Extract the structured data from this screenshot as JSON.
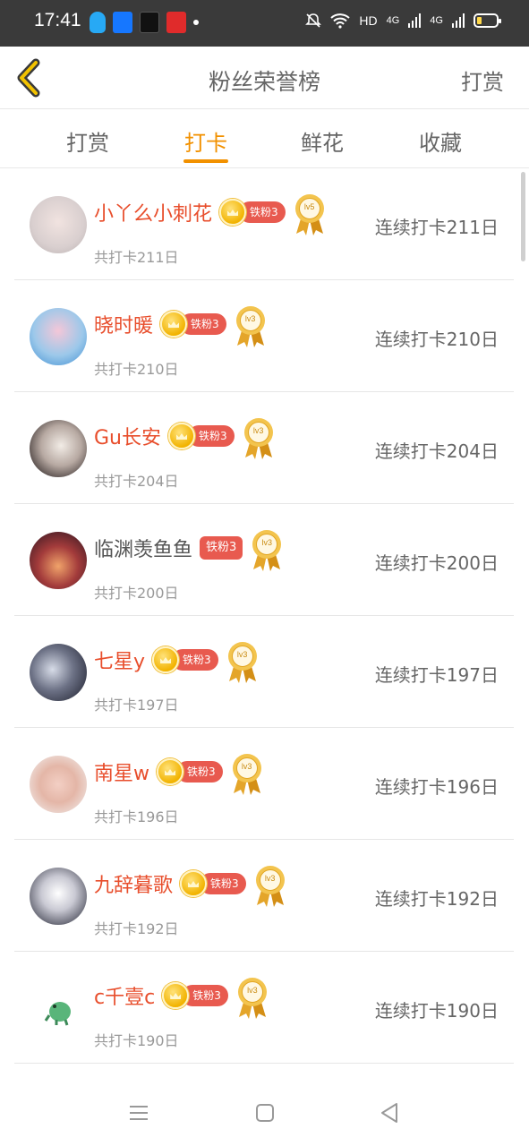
{
  "status_bar": {
    "time": "17:41",
    "network_label": "HD",
    "signal_1": "4G",
    "signal_2": "4G"
  },
  "header": {
    "title": "粉丝荣誉榜",
    "right_action": "打赏",
    "back_icon": "chevron-left-icon"
  },
  "tabs": [
    {
      "label": "打赏",
      "active": false
    },
    {
      "label": "打卡",
      "active": true
    },
    {
      "label": "鲜花",
      "active": false
    },
    {
      "label": "收藏",
      "active": false
    }
  ],
  "colors": {
    "accent": "#f29100",
    "name_red": "#e84e2c",
    "badge_red": "#e85a4f",
    "status_bar_bg": "#3a3a3a"
  },
  "rows": [
    {
      "name": "小丫么小刺花",
      "fan_label": "铁粉3",
      "medal": "lv5",
      "total": "共打卡211日",
      "streak": "连续打卡211日"
    },
    {
      "name": "晓时暖",
      "fan_label": "铁粉3",
      "medal": "lv3",
      "total": "共打卡210日",
      "streak": "连续打卡210日"
    },
    {
      "name": "Gu长安",
      "fan_label": "铁粉3",
      "medal": "lv3",
      "total": "共打卡204日",
      "streak": "连续打卡204日"
    },
    {
      "name": "临渊羡鱼鱼",
      "fan_label": "铁粉3",
      "medal": "lv3",
      "total": "共打卡200日",
      "streak": "连续打卡200日"
    },
    {
      "name": "七星y",
      "fan_label": "铁粉3",
      "medal": "lv3",
      "total": "共打卡197日",
      "streak": "连续打卡197日"
    },
    {
      "name": "南星w",
      "fan_label": "铁粉3",
      "medal": "lv3",
      "total": "共打卡196日",
      "streak": "连续打卡196日"
    },
    {
      "name": "九辞暮歌",
      "fan_label": "铁粉3",
      "medal": "lv3",
      "total": "共打卡192日",
      "streak": "连续打卡192日"
    },
    {
      "name": "c千壹c",
      "fan_label": "铁粉3",
      "medal": "lv3",
      "total": "共打卡190日",
      "streak": "连续打卡190日"
    }
  ]
}
